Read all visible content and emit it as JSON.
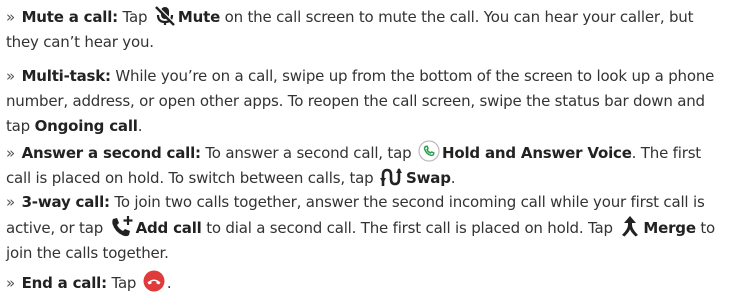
{
  "bullet_glyph": "»",
  "items": [
    {
      "title": "Mute a call:",
      "t1": " Tap ",
      "cmd": "Mute",
      "t2": " on the call screen to mute the call. You can hear your caller, but they can’t hear you.",
      "icon": "mic-off-icon"
    },
    {
      "title": "Multi-task:",
      "t1": " While you’re on a call, swipe up from the bottom of the screen to look up a phone number, address, or open other apps. To reopen the call screen, swipe the status bar down and tap ",
      "cmd": "Ongoing call",
      "t2": "."
    },
    {
      "title": "Answer a second call:",
      "t1": " To answer a second call, tap ",
      "cmd": "Hold and Answer Voice",
      "t2": ". The first call is placed on hold. To switch between calls, tap ",
      "cmd2": "Swap",
      "t3": ".",
      "icon": "phone-circle-icon",
      "icon2": "swap-icon"
    },
    {
      "title": "3-way call:",
      "t1": " To join two calls together, answer the second incoming call while your first call is active, or tap ",
      "cmd": "Add call",
      "t2": " to dial a second call. The first call is placed on hold. Tap ",
      "cmd2": "Merge",
      "t3": " to join the calls together.",
      "icon": "add-call-icon",
      "icon2": "merge-icon"
    },
    {
      "title": "End a call:",
      "t1": " Tap ",
      "t2": ".",
      "icon": "end-call-icon"
    }
  ],
  "colors": {
    "text": "#333333",
    "end_call": "#e03a3a",
    "answer_ring": "#2e9e4f"
  }
}
